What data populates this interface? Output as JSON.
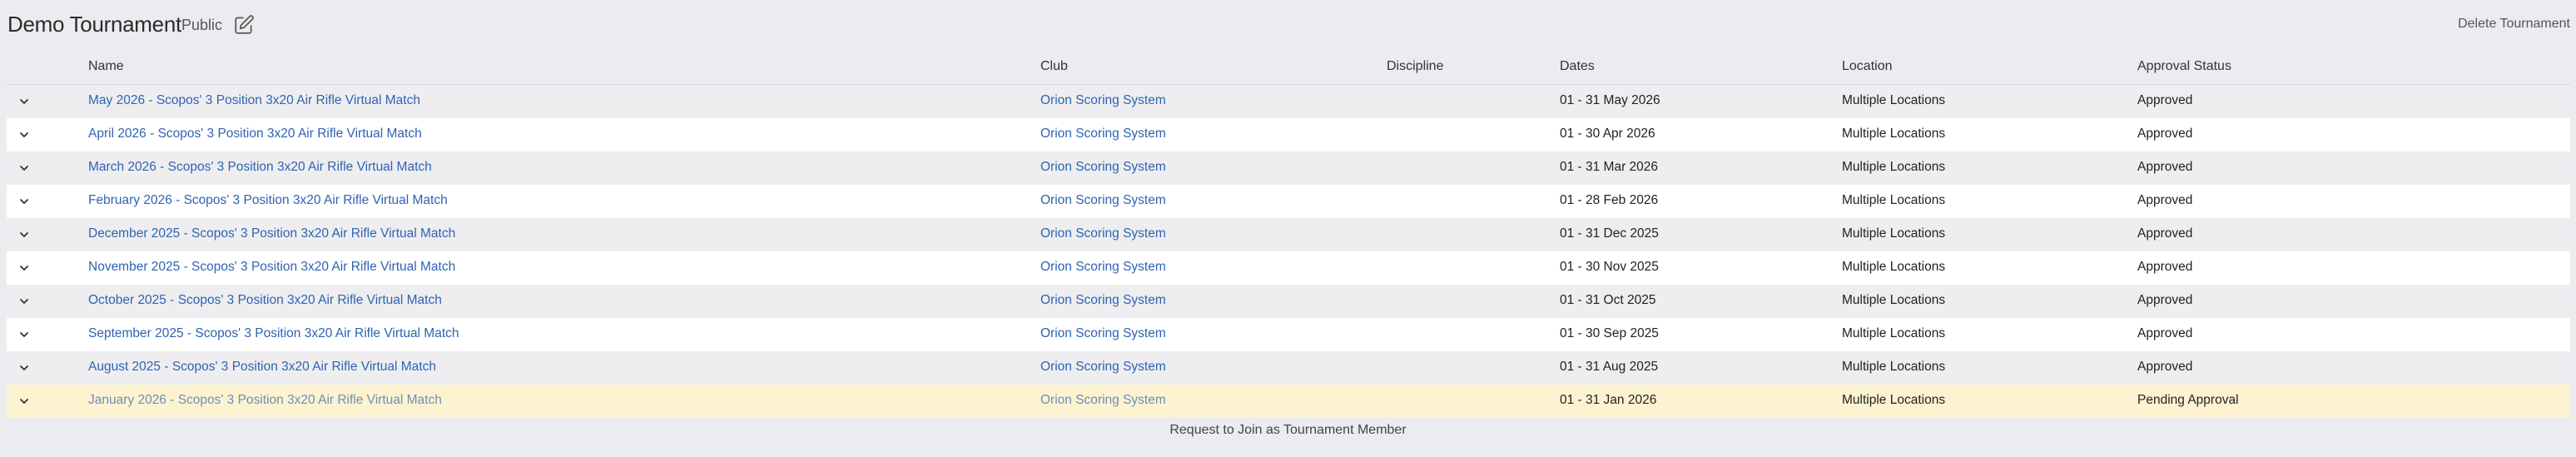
{
  "header": {
    "title": "Demo Tournament",
    "visibility": "Public",
    "edit_icon": "edit-icon",
    "delete_label": "Delete Tournament"
  },
  "table": {
    "columns": [
      "Name",
      "Club",
      "Discipline",
      "Dates",
      "Location",
      "Approval Status"
    ],
    "rows": [
      {
        "name": "May 2026 - Scopos' 3 Position 3x20 Air Rifle Virtual Match",
        "club": "Orion Scoring System",
        "discipline": "",
        "dates": "01 - 31 May 2026",
        "location": "Multiple Locations",
        "status": "Approved"
      },
      {
        "name": "April 2026 - Scopos' 3 Position 3x20 Air Rifle Virtual Match",
        "club": "Orion Scoring System",
        "discipline": "",
        "dates": "01 - 30 Apr 2026",
        "location": "Multiple Locations",
        "status": "Approved"
      },
      {
        "name": "March 2026 - Scopos' 3 Position 3x20 Air Rifle Virtual Match",
        "club": "Orion Scoring System",
        "discipline": "",
        "dates": "01 - 31 Mar 2026",
        "location": "Multiple Locations",
        "status": "Approved"
      },
      {
        "name": "February 2026 - Scopos' 3 Position 3x20 Air Rifle Virtual Match",
        "club": "Orion Scoring System",
        "discipline": "",
        "dates": "01 - 28 Feb 2026",
        "location": "Multiple Locations",
        "status": "Approved"
      },
      {
        "name": "December 2025 - Scopos' 3 Position 3x20 Air Rifle Virtual Match",
        "club": "Orion Scoring System",
        "discipline": "",
        "dates": "01 - 31 Dec 2025",
        "location": "Multiple Locations",
        "status": "Approved"
      },
      {
        "name": "November 2025 - Scopos' 3 Position 3x20 Air Rifle Virtual Match",
        "club": "Orion Scoring System",
        "discipline": "",
        "dates": "01 - 30 Nov 2025",
        "location": "Multiple Locations",
        "status": "Approved"
      },
      {
        "name": "October 2025 - Scopos' 3 Position 3x20 Air Rifle Virtual Match",
        "club": "Orion Scoring System",
        "discipline": "",
        "dates": "01 - 31 Oct 2025",
        "location": "Multiple Locations",
        "status": "Approved"
      },
      {
        "name": "September 2025 - Scopos' 3 Position 3x20 Air Rifle Virtual Match",
        "club": "Orion Scoring System",
        "discipline": "",
        "dates": "01 - 30 Sep 2025",
        "location": "Multiple Locations",
        "status": "Approved"
      },
      {
        "name": "August 2025 - Scopos' 3 Position 3x20 Air Rifle Virtual Match",
        "club": "Orion Scoring System",
        "discipline": "",
        "dates": "01 - 31 Aug 2025",
        "location": "Multiple Locations",
        "status": "Approved"
      },
      {
        "name": "January 2026 - Scopos' 3 Position 3x20 Air Rifle Virtual Match",
        "club": "Orion Scoring System",
        "discipline": "",
        "dates": "01 - 31 Jan 2026",
        "location": "Multiple Locations",
        "status": "Pending Approval"
      }
    ],
    "row_icon": "chevron-down-icon"
  },
  "footer": {
    "request_label": "Request to Join as Tournament Member"
  },
  "colors": {
    "link": "#2f63b1",
    "pending_row": "#fdf3d1",
    "background": "#ebecef"
  }
}
